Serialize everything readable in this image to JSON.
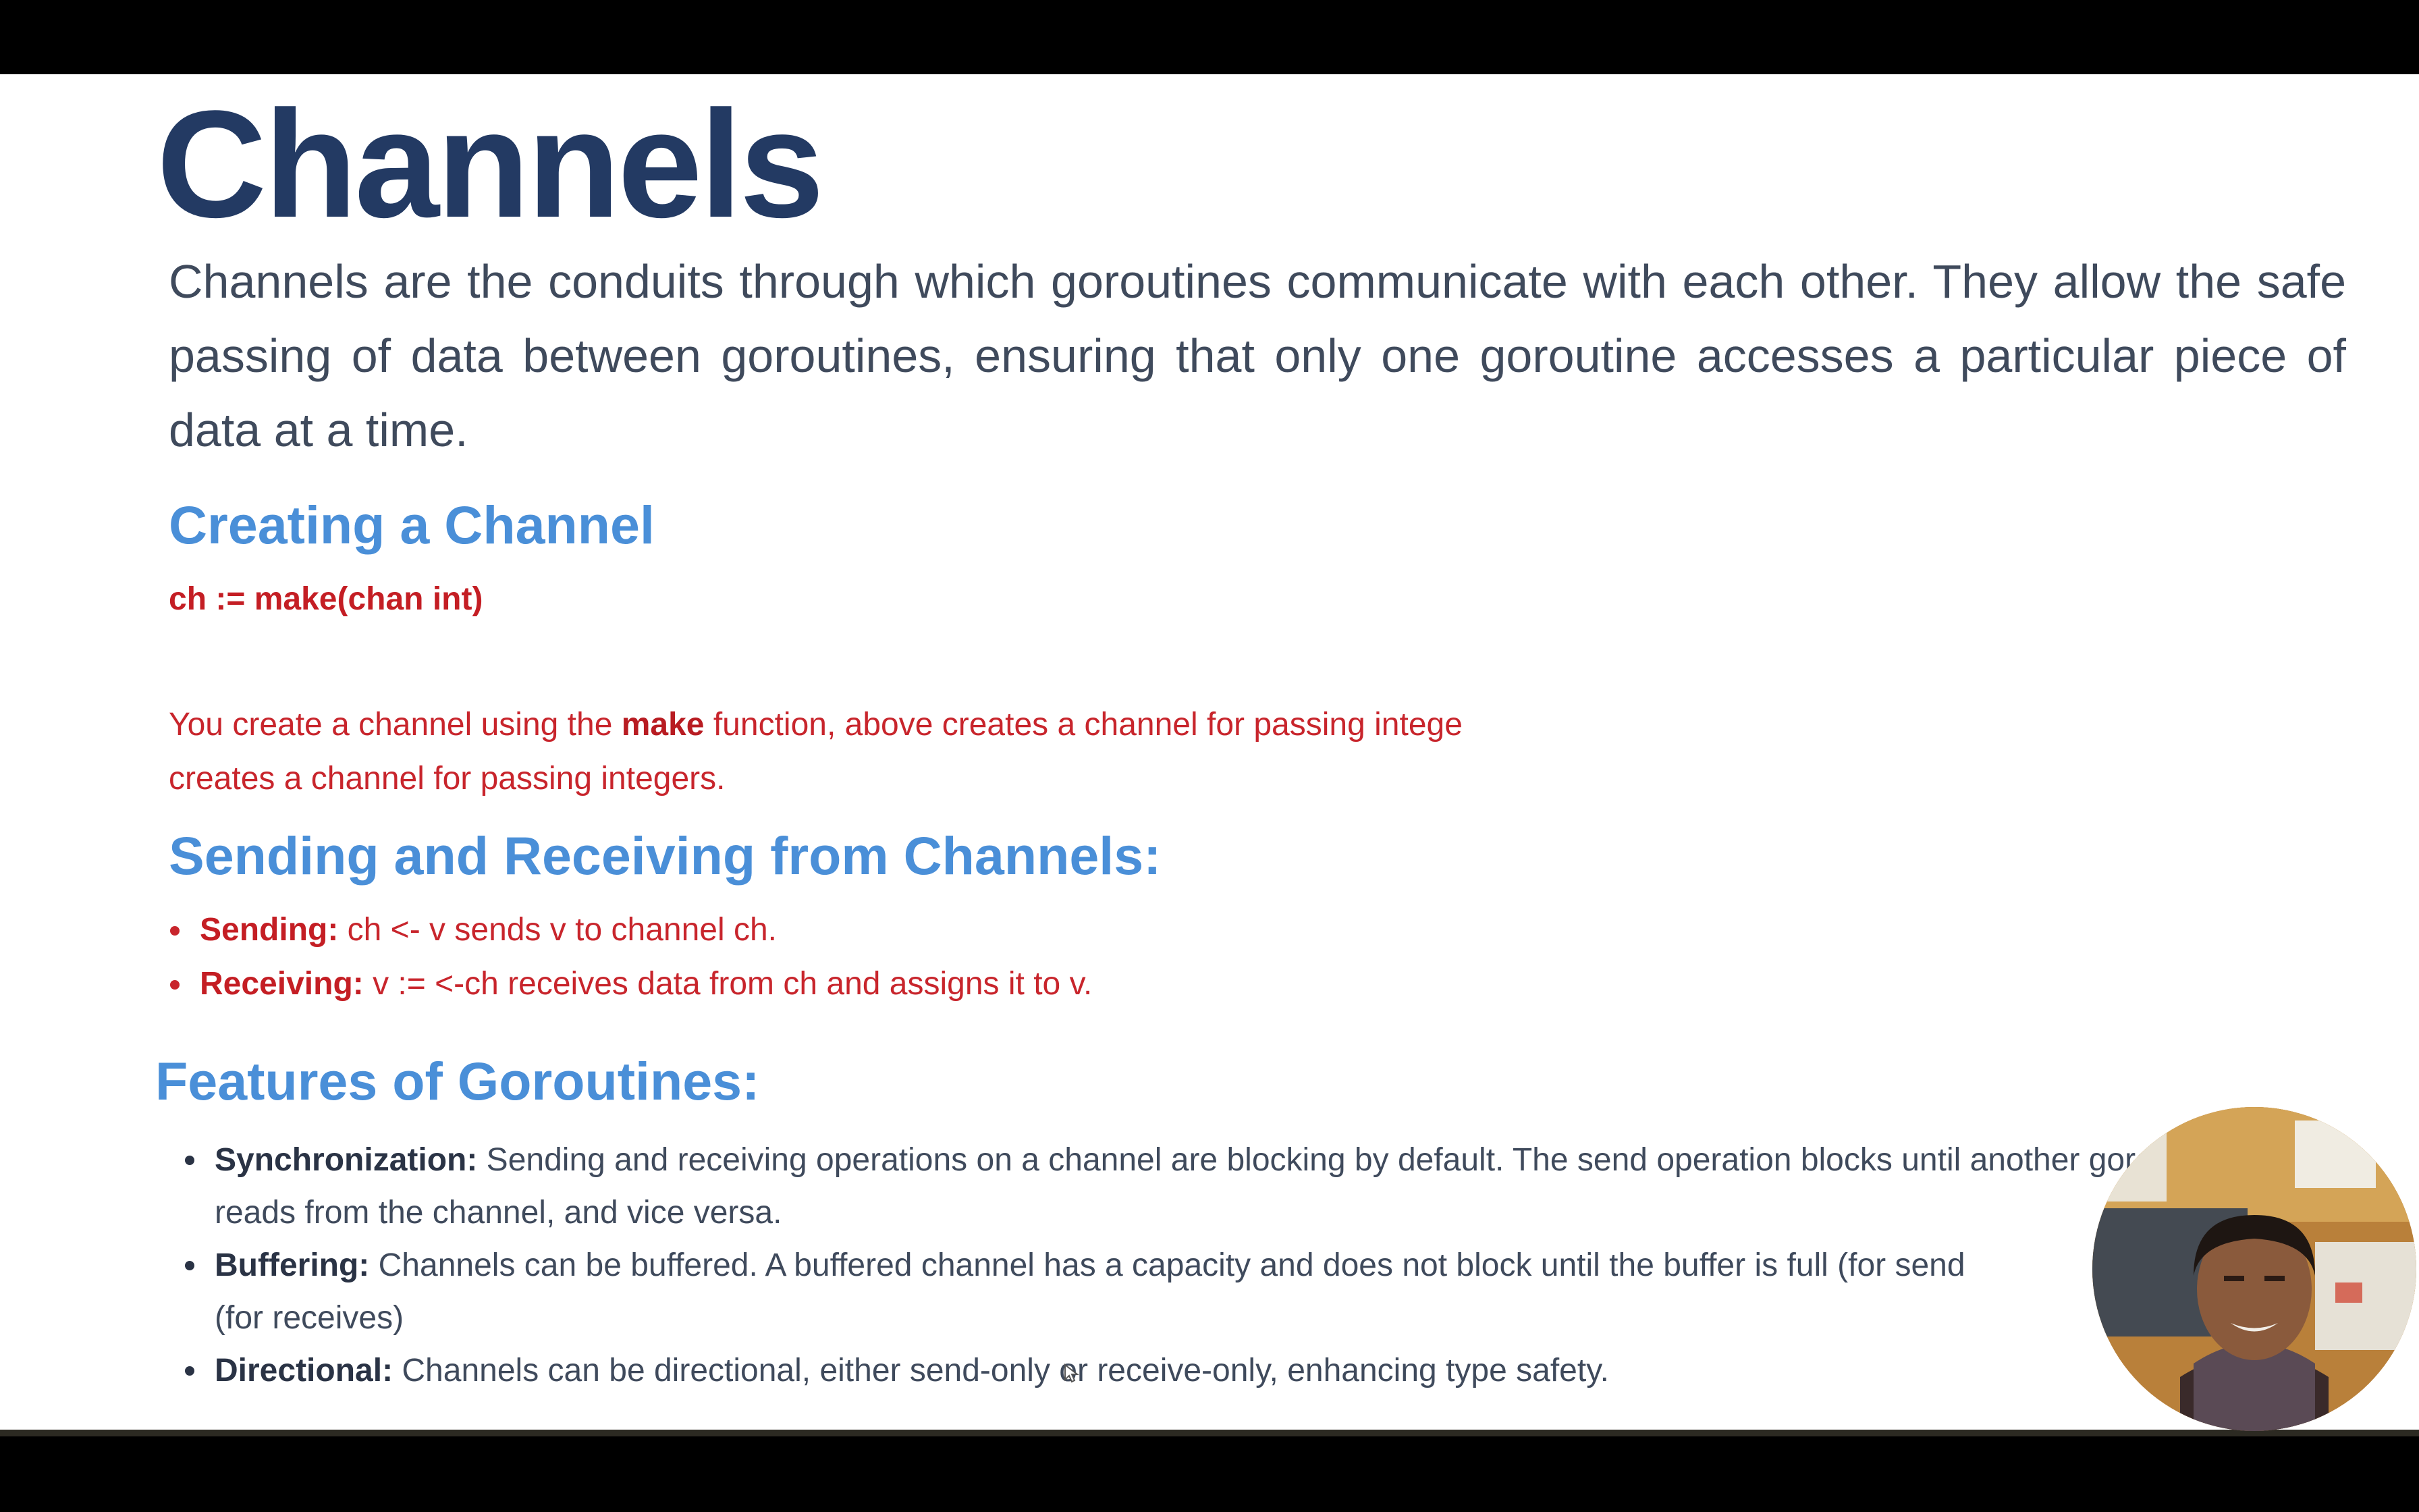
{
  "slide": {
    "title": "Channels",
    "intro": "Channels are the conduits through which goroutines communicate with each other. They allow the safe passing of data between goroutines, ensuring that only one goroutine accesses a particular piece of data at a time.",
    "creating": {
      "heading": "Creating a Channel",
      "code": "ch := make(chan int)",
      "line1_before": "You create a channel using the ",
      "line1_bold": "make",
      "line1_after": " function, above creates a channel for passing intege",
      "line2": "creates a channel for passing integers."
    },
    "sending": {
      "heading": "Sending and Receiving from Channels:",
      "items": [
        {
          "label": "Sending:",
          "text": " ch <- v sends v to channel ch."
        },
        {
          "label": "Receiving:",
          "text": " v := <-ch receives data from ch and assigns it to v."
        }
      ]
    },
    "features": {
      "heading": "Features of Goroutines:",
      "items": [
        {
          "label": "Synchronization:",
          "text": " Sending and receiving operations on a channel are blocking by default. The send operation blocks until another goroutine reads from the channel, and vice versa."
        },
        {
          "label": "Buffering:",
          "text": " Channels can be buffered. A buffered channel has a capacity and does not block until the buffer is full (for send",
          "cont": "(for receives)"
        },
        {
          "label": "Directional:",
          "text": " Channels can be directional, either send-only or receive-only, enhancing type safety."
        }
      ]
    }
  },
  "colors": {
    "title": "#233a63",
    "heading": "#4a8fd8",
    "red_text": "#c8252c",
    "body_text": "#3f4a5c"
  },
  "icons": {
    "webcam": "presenter-webcam-overlay",
    "cursor": "mouse-cursor-icon"
  }
}
